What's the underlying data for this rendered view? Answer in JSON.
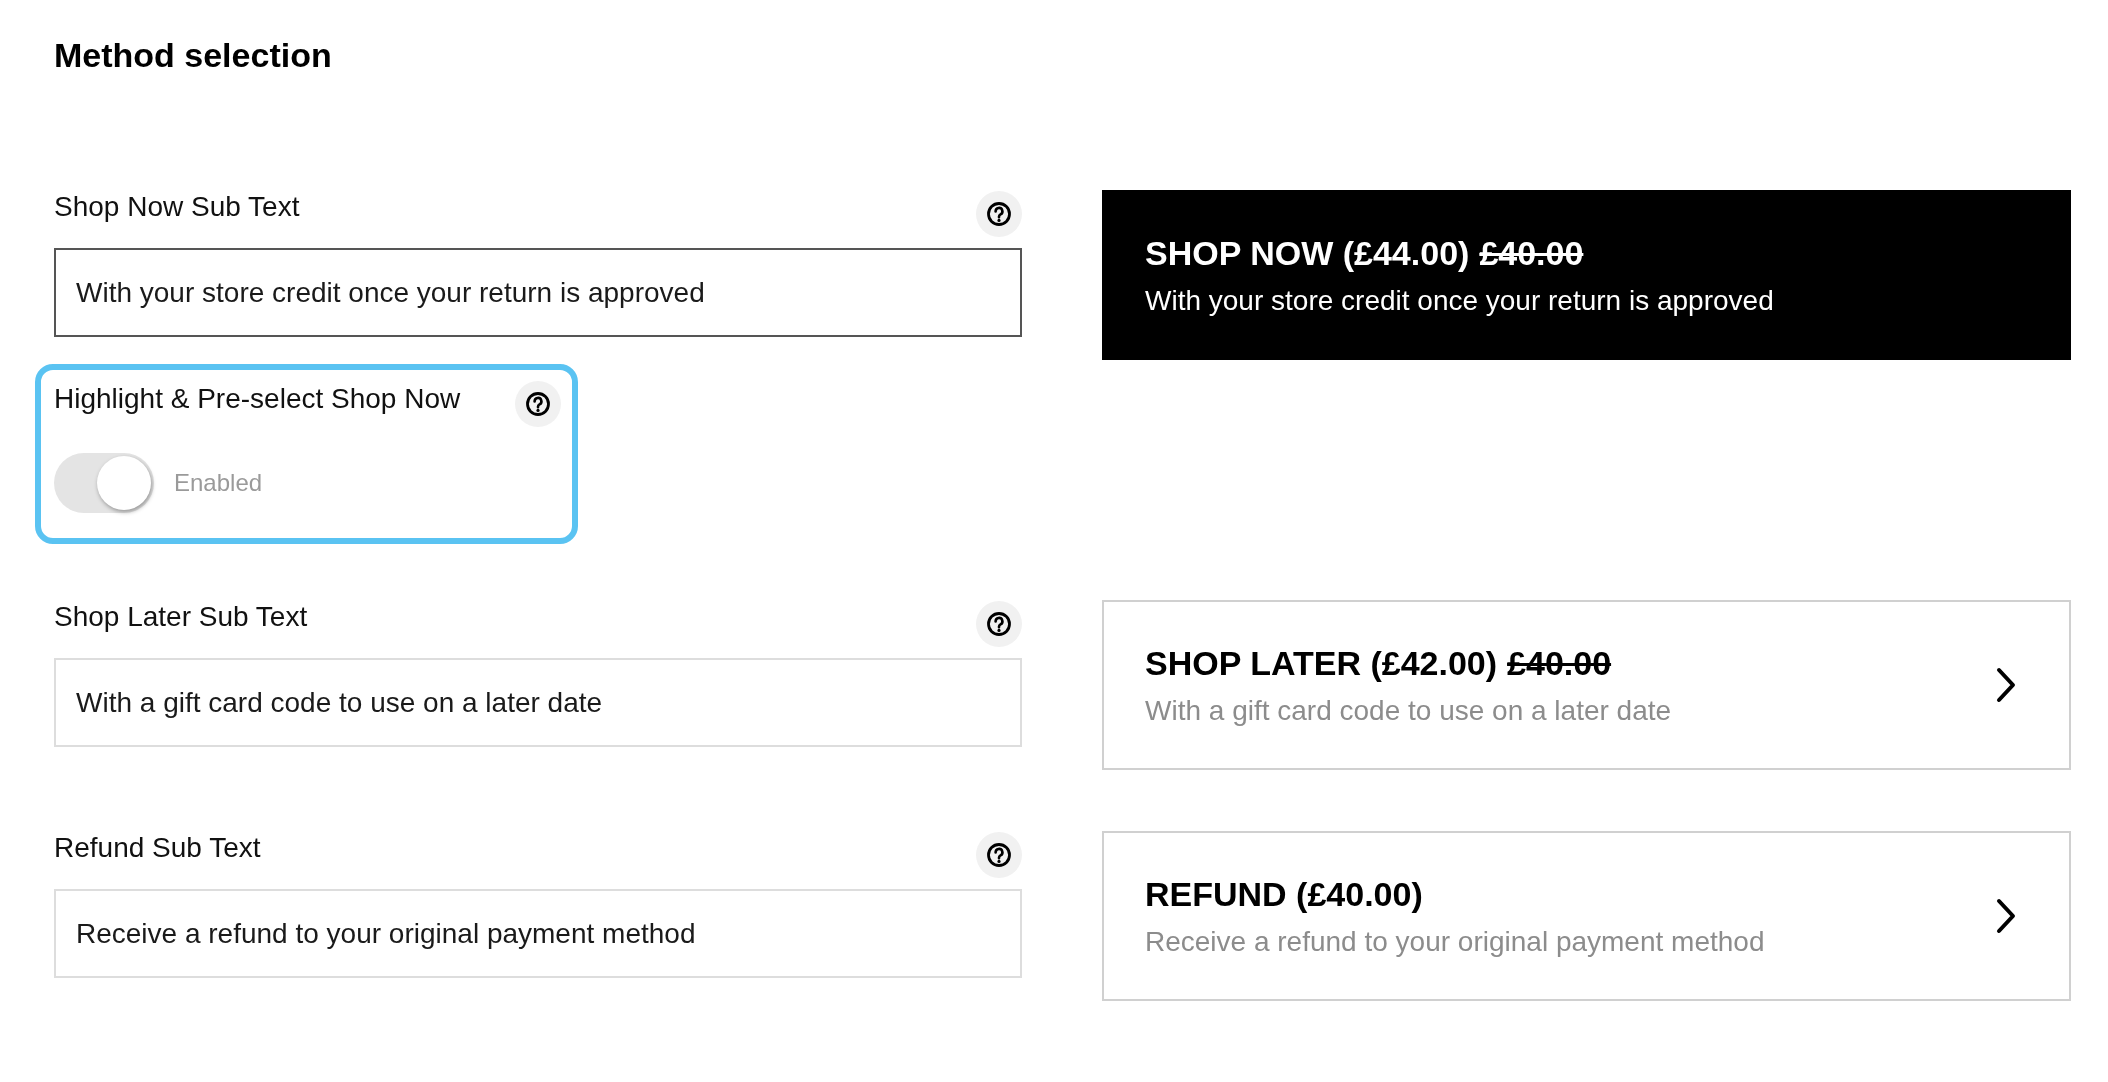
{
  "heading": "Method selection",
  "fields": [
    {
      "label": "Shop Now Sub Text",
      "value": "With your store credit once your return is approved",
      "focused": true
    },
    {
      "label": "Shop Later Sub Text",
      "value": "With a gift card code to use on a later date",
      "focused": false
    },
    {
      "label": "Refund Sub Text",
      "value": "Receive a refund to your original payment method",
      "focused": false
    }
  ],
  "highlight_toggle": {
    "label": "Highlight & Pre-select Shop Now",
    "on": true,
    "state_label": "Enabled",
    "focused": true
  },
  "options": [
    {
      "title": "SHOP NOW (£44.00)",
      "original_price": "£40.00",
      "subtitle": "With your store credit once your return is approved",
      "highlighted": true
    },
    {
      "title": "SHOP LATER (£42.00)",
      "original_price": "£40.00",
      "subtitle": "With a gift card code to use on a later date",
      "highlighted": false
    },
    {
      "title": "REFUND (£40.00)",
      "subtitle": "Receive a refund to your original payment method",
      "highlighted": false
    }
  ]
}
